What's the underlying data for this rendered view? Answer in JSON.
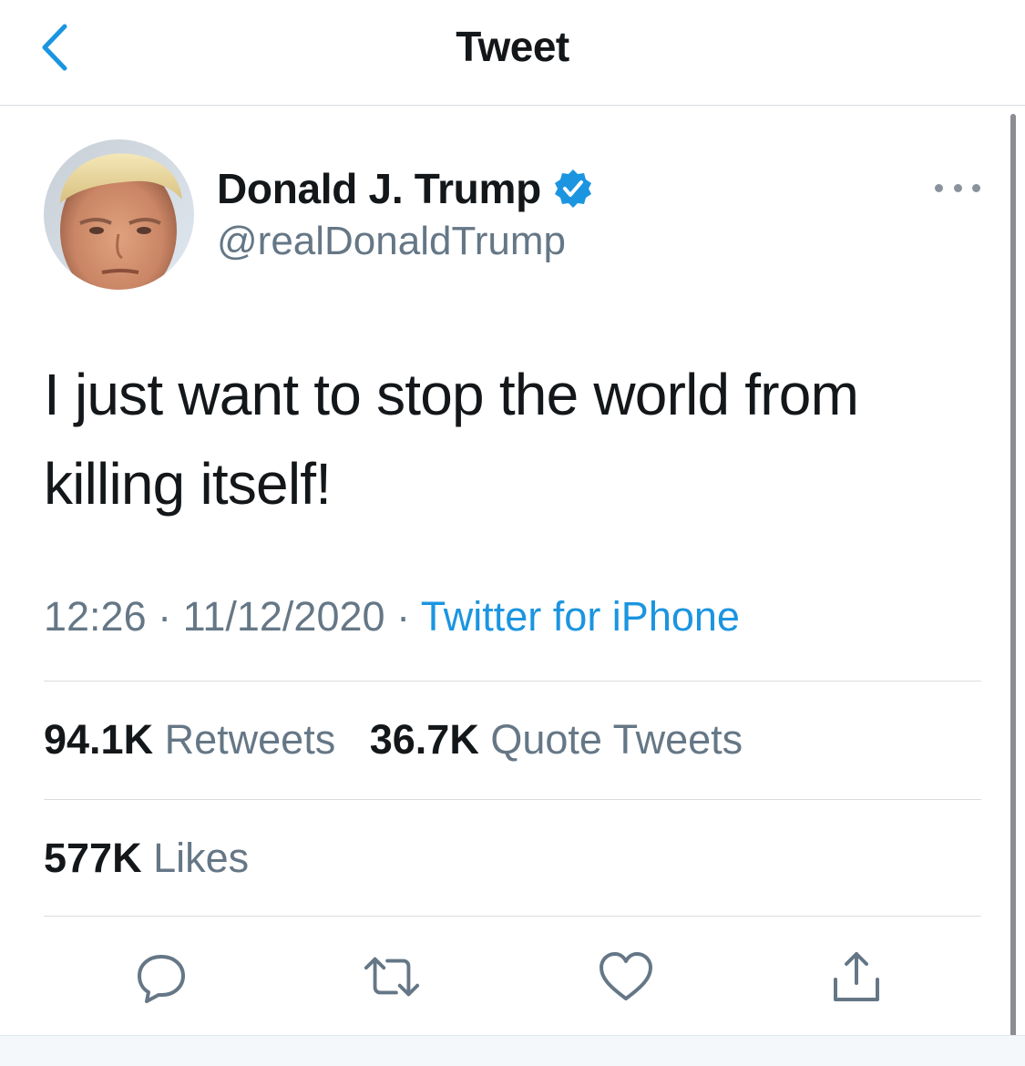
{
  "nav": {
    "title": "Tweet",
    "back_icon": "chevron-left-icon"
  },
  "colors": {
    "accent": "#1b95e0",
    "secondary_text": "#657786",
    "primary_text": "#14171a",
    "divider": "#d9dde0"
  },
  "tweet": {
    "author": {
      "display_name": "Donald J. Trump",
      "handle": "@realDonaldTrump",
      "verified_icon": "verified-badge-icon"
    },
    "text": "I just want to stop the world from killing itself!",
    "time": "12:26",
    "date": "11/12/2020",
    "separator": "·",
    "source": "Twitter for iPhone",
    "stats": {
      "retweets_count": "94.1K",
      "retweets_label": "Retweets",
      "quotes_count": "36.7K",
      "quotes_label": "Quote Tweets",
      "likes_count": "577K",
      "likes_label": "Likes"
    }
  },
  "actions": [
    {
      "name": "reply",
      "icon": "reply-icon"
    },
    {
      "name": "retweet",
      "icon": "retweet-icon"
    },
    {
      "name": "like",
      "icon": "heart-icon"
    },
    {
      "name": "share",
      "icon": "share-icon"
    }
  ]
}
